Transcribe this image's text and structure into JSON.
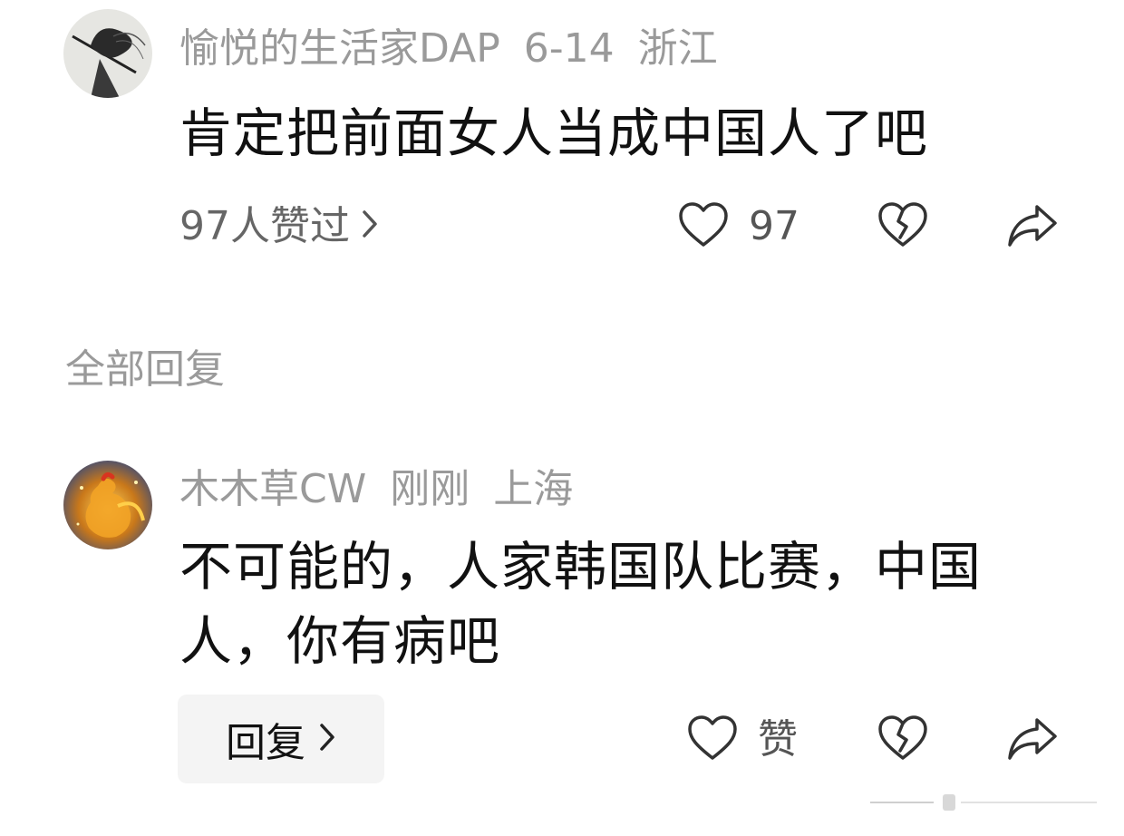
{
  "comment": {
    "username": "愉悦的生活家DAP",
    "date": "6-14",
    "location": "浙江",
    "content": "肯定把前面女人当成中国人了吧",
    "likers_link": "97人赞过",
    "like_count": "97"
  },
  "replies_section": {
    "label": "全部回复"
  },
  "reply": {
    "username": "木木草CW",
    "time": "刚刚",
    "location": "上海",
    "content": "不可能的，人家韩国队比赛，中国人，你有病吧",
    "reply_button_label": "回复",
    "like_label": "赞"
  },
  "icons": [
    "heart-icon",
    "broken-heart-icon",
    "share-icon",
    "chevron-right-icon"
  ],
  "colors": {
    "meta_text": "#9a9a9a",
    "body_text": "#111111",
    "icon_stroke": "#333333",
    "button_bg": "#f4f4f4"
  }
}
